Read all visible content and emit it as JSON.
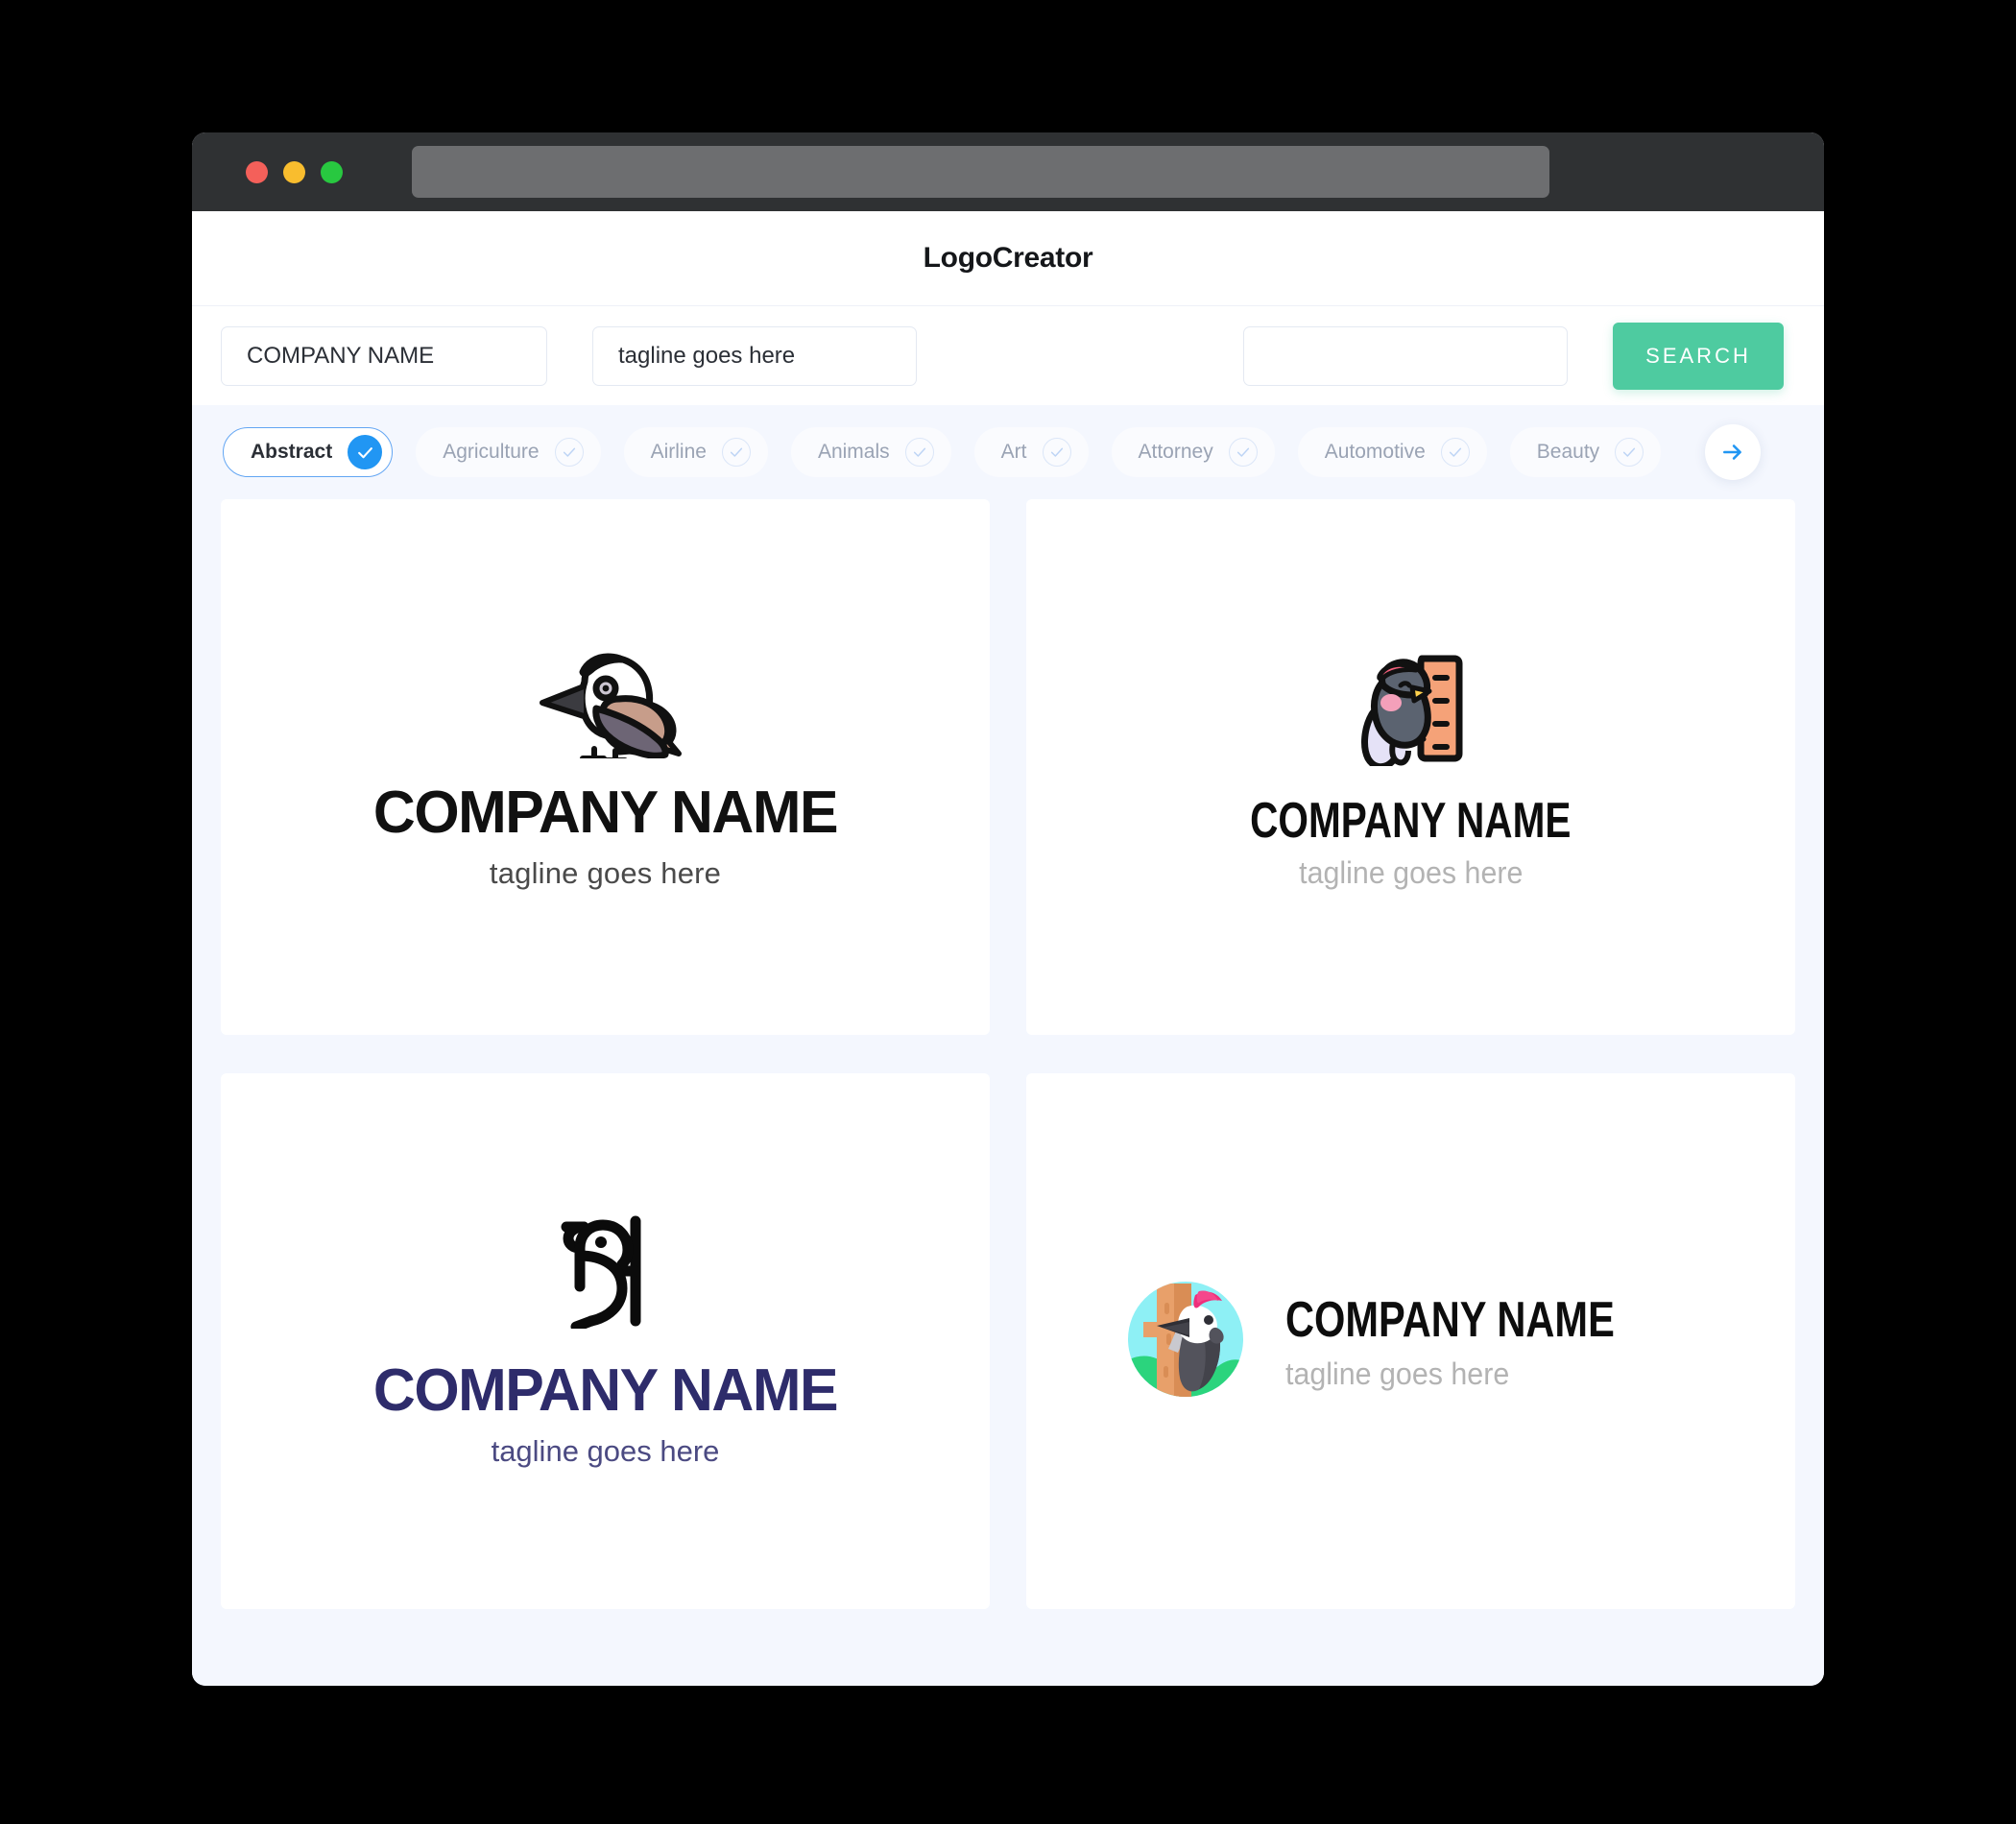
{
  "window": {
    "traffic_lights": [
      "close",
      "minimize",
      "maximize"
    ],
    "url_value": ""
  },
  "header": {
    "app_title": "LogoCreator"
  },
  "search": {
    "company_name_value": "COMPANY NAME",
    "company_name_placeholder": "COMPANY NAME",
    "tagline_value": "tagline goes here",
    "tagline_placeholder": "tagline goes here",
    "keyword_value": "",
    "keyword_placeholder": "",
    "search_button_label": "SEARCH"
  },
  "categories": {
    "next_arrow_icon": "arrow-right-icon",
    "items": [
      {
        "label": "Abstract",
        "selected": true
      },
      {
        "label": "Agriculture",
        "selected": false
      },
      {
        "label": "Airline",
        "selected": false
      },
      {
        "label": "Animals",
        "selected": false
      },
      {
        "label": "Art",
        "selected": false
      },
      {
        "label": "Attorney",
        "selected": false
      },
      {
        "label": "Automotive",
        "selected": false
      },
      {
        "label": "Beauty",
        "selected": false
      }
    ]
  },
  "results": {
    "cards": [
      {
        "id": "card-1",
        "icon": "woodpecker-bird-outline-icon",
        "name": "COMPANY NAME",
        "tagline": "tagline goes here",
        "name_color": "#111111",
        "tagline_color": "#4a4a4a",
        "layout": "stacked"
      },
      {
        "id": "card-2",
        "icon": "cartoon-woodpecker-on-trunk-icon",
        "name": "COMPANY NAME",
        "tagline": "tagline goes here",
        "name_color": "#0d0d0d",
        "tagline_color": "#b3b3b3",
        "layout": "stacked"
      },
      {
        "id": "card-3",
        "icon": "woodpecker-line-monogram-icon",
        "name": "COMPANY NAME",
        "tagline": "tagline goes here",
        "name_color": "#2e2c6b",
        "tagline_color": "#4b4a82",
        "layout": "stacked"
      },
      {
        "id": "card-4",
        "icon": "woodpecker-circle-badge-icon",
        "name": "COMPANY NAME",
        "tagline": "tagline goes here",
        "name_color": "#0d0d0d",
        "tagline_color": "#b3b3b3",
        "layout": "horizontal"
      }
    ]
  },
  "colors": {
    "accent_green": "#4ecba0",
    "accent_blue": "#2196f3",
    "page_background": "#f4f7fe",
    "card_background": "#ffffff",
    "titlebar": "#2f3133"
  }
}
